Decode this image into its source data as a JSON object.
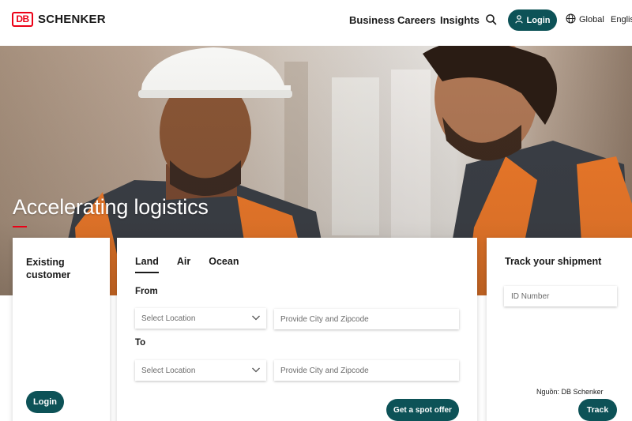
{
  "brand": {
    "logo_mark": "DB",
    "logo_text": "SCHENKER",
    "accent_color": "#ec0016",
    "primary_color": "#0d5257"
  },
  "nav": {
    "items": [
      "Business",
      "Careers",
      "Insights"
    ],
    "search_icon": "search-icon",
    "login_label": "Login",
    "global_label": "Global",
    "language_label": "English"
  },
  "hero": {
    "title": "Accelerating logistics"
  },
  "existing_customer": {
    "title": "Existing customer",
    "login_label": "Login"
  },
  "quote": {
    "tabs": [
      {
        "label": "Land",
        "active": true
      },
      {
        "label": "Air",
        "active": false
      },
      {
        "label": "Ocean",
        "active": false
      }
    ],
    "from_label": "From",
    "to_label": "To",
    "select_placeholder": "Select Location",
    "city_placeholder": "Provide City and Zipcode",
    "spot_offer_label": "Get a spot offer"
  },
  "tracking": {
    "title": "Track your shipment",
    "id_placeholder": "ID Number",
    "track_label": "Track",
    "source_note": "Nguồn: DB Schenker"
  }
}
